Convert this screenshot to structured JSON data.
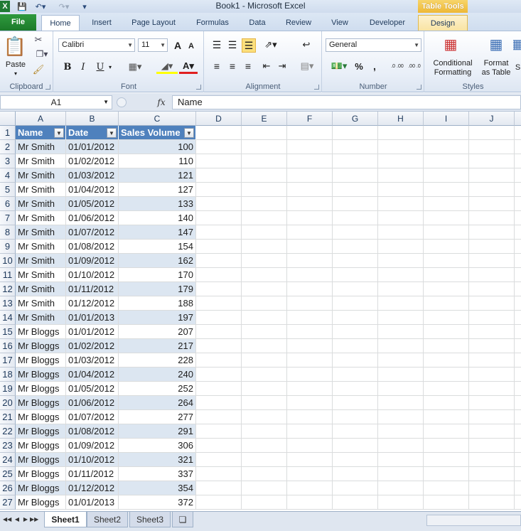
{
  "window": {
    "title": "Book1 - Microsoft Excel",
    "contextual_tab_group": "Table Tools"
  },
  "tabs": [
    "File",
    "Home",
    "Insert",
    "Page Layout",
    "Formulas",
    "Data",
    "Review",
    "View",
    "Developer",
    "Design"
  ],
  "ribbon": {
    "clipboard": {
      "label": "Clipboard",
      "paste": "Paste"
    },
    "font": {
      "label": "Font",
      "font_name": "Calibri",
      "font_size": "11",
      "bold": "B",
      "italic": "I",
      "underline": "U",
      "grow": "A",
      "shrink": "A"
    },
    "alignment": {
      "label": "Alignment"
    },
    "number": {
      "label": "Number",
      "format": "General",
      "percent": "%",
      "comma": ",",
      "inc_decimal": ".0 .00",
      "dec_decimal": ".00 .0"
    },
    "styles": {
      "label": "Styles",
      "conditional_line1": "Conditional",
      "conditional_line2": "Formatting",
      "format_line1": "Format",
      "format_line2": "as Table",
      "cell_styles": "S"
    }
  },
  "formula_bar": {
    "name_box": "A1",
    "fx": "fx",
    "formula": "Name"
  },
  "columns": [
    "A",
    "B",
    "C",
    "D",
    "E",
    "F",
    "G",
    "H",
    "I",
    "J"
  ],
  "table": {
    "headers": [
      "Name",
      "Date",
      "Sales Volume"
    ],
    "rows": [
      [
        "Mr Smith",
        "01/01/2012",
        "100"
      ],
      [
        "Mr Smith",
        "01/02/2012",
        "110"
      ],
      [
        "Mr Smith",
        "01/03/2012",
        "121"
      ],
      [
        "Mr Smith",
        "01/04/2012",
        "127"
      ],
      [
        "Mr Smith",
        "01/05/2012",
        "133"
      ],
      [
        "Mr Smith",
        "01/06/2012",
        "140"
      ],
      [
        "Mr Smith",
        "01/07/2012",
        "147"
      ],
      [
        "Mr Smith",
        "01/08/2012",
        "154"
      ],
      [
        "Mr Smith",
        "01/09/2012",
        "162"
      ],
      [
        "Mr Smith",
        "01/10/2012",
        "170"
      ],
      [
        "Mr Smith",
        "01/11/2012",
        "179"
      ],
      [
        "Mr Smith",
        "01/12/2012",
        "188"
      ],
      [
        "Mr Smith",
        "01/01/2013",
        "197"
      ],
      [
        "Mr Bloggs",
        "01/01/2012",
        "207"
      ],
      [
        "Mr Bloggs",
        "01/02/2012",
        "217"
      ],
      [
        "Mr Bloggs",
        "01/03/2012",
        "228"
      ],
      [
        "Mr Bloggs",
        "01/04/2012",
        "240"
      ],
      [
        "Mr Bloggs",
        "01/05/2012",
        "252"
      ],
      [
        "Mr Bloggs",
        "01/06/2012",
        "264"
      ],
      [
        "Mr Bloggs",
        "01/07/2012",
        "277"
      ],
      [
        "Mr Bloggs",
        "01/08/2012",
        "291"
      ],
      [
        "Mr Bloggs",
        "01/09/2012",
        "306"
      ],
      [
        "Mr Bloggs",
        "01/10/2012",
        "321"
      ],
      [
        "Mr Bloggs",
        "01/11/2012",
        "337"
      ],
      [
        "Mr Bloggs",
        "01/12/2012",
        "354"
      ],
      [
        "Mr Bloggs",
        "01/01/2013",
        "372"
      ]
    ]
  },
  "sheets": [
    "Sheet1",
    "Sheet2",
    "Sheet3"
  ],
  "colors": {
    "table_header": "#4f81bd",
    "band": "#dce6f1",
    "file_tab": "#1c7a2a",
    "table_tools": "#edb530"
  }
}
